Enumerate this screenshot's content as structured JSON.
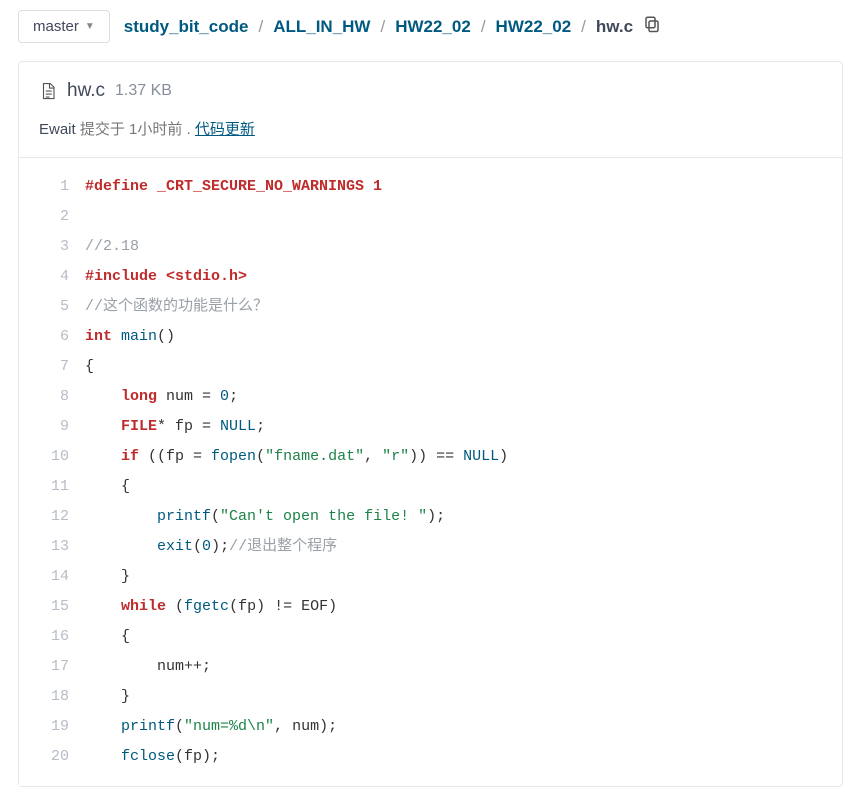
{
  "branch": {
    "label": "master"
  },
  "breadcrumb": {
    "items": [
      {
        "label": "study_bit_code",
        "link": true
      },
      {
        "label": "ALL_IN_HW",
        "link": true
      },
      {
        "label": "HW22_02",
        "link": true
      },
      {
        "label": "HW22_02",
        "link": true
      },
      {
        "label": "hw.c",
        "link": false
      }
    ]
  },
  "file": {
    "name": "hw.c",
    "size": "1.37 KB"
  },
  "commit": {
    "author": "Ewait",
    "action": "提交于",
    "time": "1小时前",
    "dot": ".",
    "message": "代码更新"
  },
  "code": {
    "lines": [
      {
        "num": 1,
        "tokens": [
          [
            "macro",
            "#define "
          ],
          [
            "macro-val",
            "_CRT_SECURE_NO_WARNINGS 1"
          ]
        ]
      },
      {
        "num": 2,
        "tokens": []
      },
      {
        "num": 3,
        "tokens": [
          [
            "comment",
            "//2.18"
          ]
        ]
      },
      {
        "num": 4,
        "tokens": [
          [
            "macro",
            "#include "
          ],
          [
            "macro-val",
            "<stdio.h>"
          ]
        ]
      },
      {
        "num": 5,
        "tokens": [
          [
            "comment",
            "//这个函数的功能是什么？"
          ]
        ]
      },
      {
        "num": 6,
        "tokens": [
          [
            "keyword",
            "int"
          ],
          [
            "op",
            " "
          ],
          [
            "func",
            "main"
          ],
          [
            "op",
            "()"
          ]
        ]
      },
      {
        "num": 7,
        "tokens": [
          [
            "op",
            "{"
          ]
        ]
      },
      {
        "num": 8,
        "tokens": [
          [
            "op",
            "    "
          ],
          [
            "keyword",
            "long"
          ],
          [
            "op",
            " num = "
          ],
          [
            "num",
            "0"
          ],
          [
            "op",
            ";"
          ]
        ]
      },
      {
        "num": 9,
        "tokens": [
          [
            "op",
            "    "
          ],
          [
            "type",
            "FILE"
          ],
          [
            "op",
            "* fp = "
          ],
          [
            "null",
            "NULL"
          ],
          [
            "op",
            ";"
          ]
        ]
      },
      {
        "num": 10,
        "tokens": [
          [
            "op",
            "    "
          ],
          [
            "keyword",
            "if"
          ],
          [
            "op",
            " ((fp = "
          ],
          [
            "func",
            "fopen"
          ],
          [
            "op",
            "("
          ],
          [
            "string",
            "\"fname.dat\""
          ],
          [
            "op",
            ", "
          ],
          [
            "string",
            "\"r\""
          ],
          [
            "op",
            ")) == "
          ],
          [
            "null",
            "NULL"
          ],
          [
            "op",
            ")"
          ]
        ]
      },
      {
        "num": 11,
        "tokens": [
          [
            "op",
            "    {"
          ]
        ]
      },
      {
        "num": 12,
        "tokens": [
          [
            "op",
            "        "
          ],
          [
            "func",
            "printf"
          ],
          [
            "op",
            "("
          ],
          [
            "string",
            "\"Can't open the file! \""
          ],
          [
            "op",
            ");"
          ]
        ]
      },
      {
        "num": 13,
        "tokens": [
          [
            "op",
            "        "
          ],
          [
            "func",
            "exit"
          ],
          [
            "op",
            "("
          ],
          [
            "num",
            "0"
          ],
          [
            "op",
            ");"
          ],
          [
            "comment",
            "//退出整个程序"
          ]
        ]
      },
      {
        "num": 14,
        "tokens": [
          [
            "op",
            "    }"
          ]
        ]
      },
      {
        "num": 15,
        "tokens": [
          [
            "op",
            "    "
          ],
          [
            "keyword",
            "while"
          ],
          [
            "op",
            " ("
          ],
          [
            "func",
            "fgetc"
          ],
          [
            "op",
            "(fp) != EOF)"
          ]
        ]
      },
      {
        "num": 16,
        "tokens": [
          [
            "op",
            "    {"
          ]
        ]
      },
      {
        "num": 17,
        "tokens": [
          [
            "op",
            "        num++;"
          ]
        ]
      },
      {
        "num": 18,
        "tokens": [
          [
            "op",
            "    }"
          ]
        ]
      },
      {
        "num": 19,
        "tokens": [
          [
            "op",
            "    "
          ],
          [
            "func",
            "printf"
          ],
          [
            "op",
            "("
          ],
          [
            "string",
            "\"num=%d\\n\""
          ],
          [
            "op",
            ", num);"
          ]
        ]
      },
      {
        "num": 20,
        "tokens": [
          [
            "op",
            "    "
          ],
          [
            "func",
            "fclose"
          ],
          [
            "op",
            "(fp);"
          ]
        ]
      }
    ]
  }
}
